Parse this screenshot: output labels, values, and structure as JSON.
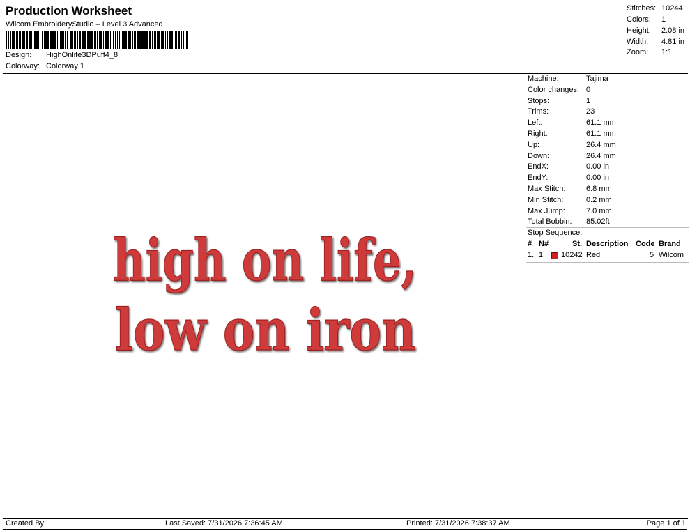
{
  "header": {
    "title": "Production Worksheet",
    "subtitle": "Wilcom EmbroideryStudio – Level 3 Advanced",
    "design_label": "Design:",
    "design_value": "HighOnlife3DPuff4_8",
    "colorway_label": "Colorway:",
    "colorway_value": "Colorway 1"
  },
  "summary": [
    {
      "label": "Stitches:",
      "value": "10244"
    },
    {
      "label": "Colors:",
      "value": "1"
    },
    {
      "label": "Height:",
      "value": "2.08 in"
    },
    {
      "label": "Width:",
      "value": "4.81 in"
    },
    {
      "label": "Zoom:",
      "value": "1:1"
    }
  ],
  "design_text": {
    "line1": "high on life,",
    "line2": "low on iron",
    "color": "#cf3a3a"
  },
  "stats": [
    {
      "label": "Machine:",
      "value": "Tajima"
    },
    {
      "label": "Color changes:",
      "value": "0"
    },
    {
      "label": "Stops:",
      "value": "1"
    },
    {
      "label": "Trims:",
      "value": "23"
    },
    {
      "label": "Left:",
      "value": "61.1 mm"
    },
    {
      "label": "Right:",
      "value": "61.1 mm"
    },
    {
      "label": "Up:",
      "value": "26.4 mm"
    },
    {
      "label": "Down:",
      "value": "26.4 mm"
    },
    {
      "label": "EndX:",
      "value": "0.00 in"
    },
    {
      "label": "EndY:",
      "value": "0.00 in"
    },
    {
      "label": "Max Stitch:",
      "value": "6.8 mm"
    },
    {
      "label": "Min Stitch:",
      "value": "0.2 mm"
    },
    {
      "label": "Max Jump:",
      "value": "7.0 mm"
    },
    {
      "label": "Total Bobbin:",
      "value": "85.02ft"
    }
  ],
  "stop_sequence": {
    "title": "Stop Sequence:",
    "headers": {
      "num": "#",
      "n": "N#",
      "st": "St.",
      "description": "Description",
      "code": "Code",
      "brand": "Brand"
    },
    "rows": [
      {
        "num": "1.",
        "n": "1",
        "st": "10242",
        "description": "Red",
        "code": "5",
        "brand": "Wilcom",
        "color": "#cc1f2a"
      }
    ]
  },
  "footer": {
    "created_by": "Created By:",
    "last_saved": "Last Saved: 7/31/2026 7:36:45 AM",
    "printed": "Printed: 7/31/2026 7:38:37 AM",
    "page": "Page 1 of 1"
  }
}
